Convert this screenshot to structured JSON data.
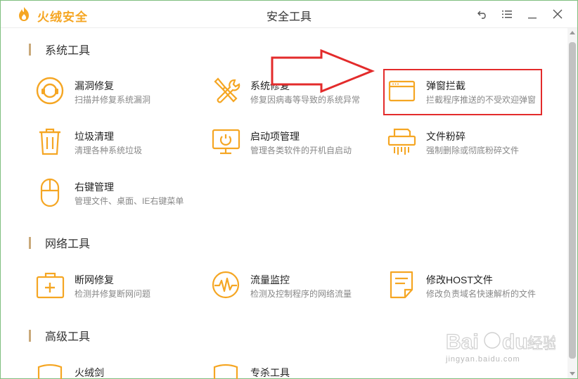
{
  "app": {
    "brand": "火绒安全",
    "window_title": "安全工具"
  },
  "sections": [
    {
      "label": "系统工具"
    },
    {
      "label": "网络工具"
    },
    {
      "label": "高级工具"
    }
  ],
  "tools": {
    "vuln_repair": {
      "name": "漏洞修复",
      "desc": "扫描并修复系统漏洞"
    },
    "sys_repair": {
      "name": "系统修复",
      "desc": "修复因病毒等导致的系统异常"
    },
    "popup_block": {
      "name": "弹窗拦截",
      "desc": "拦截程序推送的不受欢迎弹窗"
    },
    "junk_clean": {
      "name": "垃圾清理",
      "desc": "清理各种系统垃圾"
    },
    "startup_mgr": {
      "name": "启动项管理",
      "desc": "管理各类软件的开机自启动"
    },
    "file_shred": {
      "name": "文件粉碎",
      "desc": "强制删除或彻底粉碎文件"
    },
    "rclick_mgr": {
      "name": "右键管理",
      "desc": "管理文件、桌面、IE右键菜单"
    },
    "net_repair": {
      "name": "断网修复",
      "desc": "检测并修复断网问题"
    },
    "traffic_mon": {
      "name": "流量监控",
      "desc": "检测及控制程序的网络流量"
    },
    "host_edit": {
      "name": "修改HOST文件",
      "desc": "修改负责域名快速解析的文件"
    },
    "adv_1": {
      "name": "火绒剑"
    },
    "adv_2": {
      "name": "专杀工具"
    }
  },
  "watermark": {
    "text": "jingyan.baidu.com",
    "logo_text": "Bai du 经验"
  },
  "colors": {
    "accent": "#f5a623",
    "highlight": "#e32b2b",
    "section_bar": "#c9a97a"
  },
  "icons": {
    "logo": "huorong-flame-logo",
    "back": "back-arrow-icon",
    "menu": "menu-icon",
    "minimize": "minimize-icon",
    "close": "close-icon"
  }
}
